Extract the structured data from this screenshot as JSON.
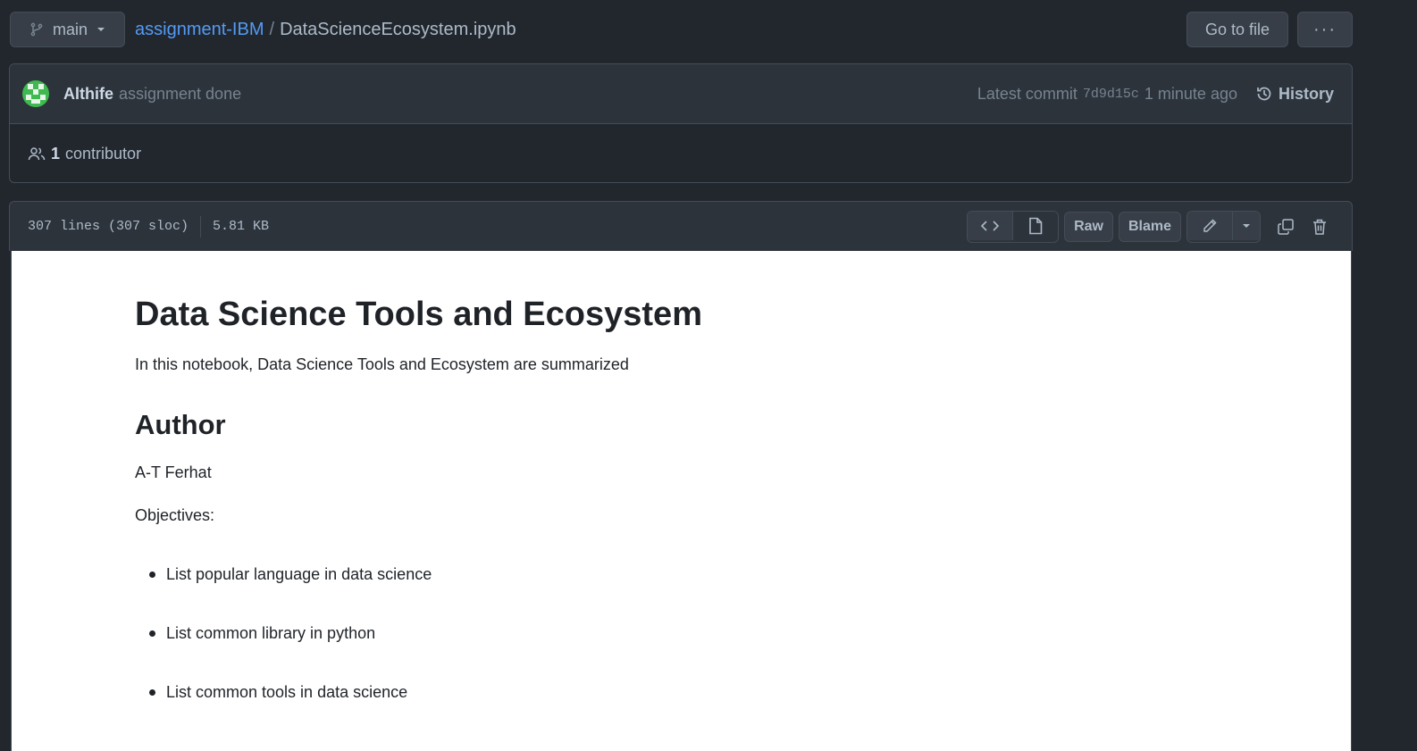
{
  "topbar": {
    "branch": "main",
    "repo": "assignment-IBM",
    "separator": "/",
    "file": "DataScienceEcosystem.ipynb",
    "goto_file": "Go to file",
    "more": "···"
  },
  "commit": {
    "author": "Althife",
    "message": "assignment done",
    "latest_label": "Latest commit",
    "sha": "7d9d15c",
    "time": "1 minute ago",
    "history": "History"
  },
  "contributors": {
    "count": "1",
    "label": "contributor"
  },
  "file_header": {
    "lines": "307 lines (307 sloc)",
    "size": "5.81 KB",
    "raw": "Raw",
    "blame": "Blame"
  },
  "notebook": {
    "title": "Data Science Tools and Ecosystem",
    "intro": "In this notebook, Data Science Tools and Ecosystem are summarized",
    "author_heading": "Author",
    "author_name": "A-T Ferhat",
    "objectives_label": "Objectives:",
    "objectives": [
      "List popular language in data science",
      "List common library in python",
      "List common tools in data science"
    ]
  },
  "colors": {
    "background": "#22272e",
    "panel": "#2d333b",
    "border": "#444c56",
    "link": "#539bf5",
    "text": "#adbac7",
    "muted": "#768390",
    "content_bg": "#ffffff"
  },
  "icons": [
    "git-branch-icon",
    "caret-down-icon",
    "history-icon",
    "people-icon",
    "code-icon",
    "file-icon",
    "pencil-icon",
    "copy-icon",
    "trash-icon"
  ]
}
